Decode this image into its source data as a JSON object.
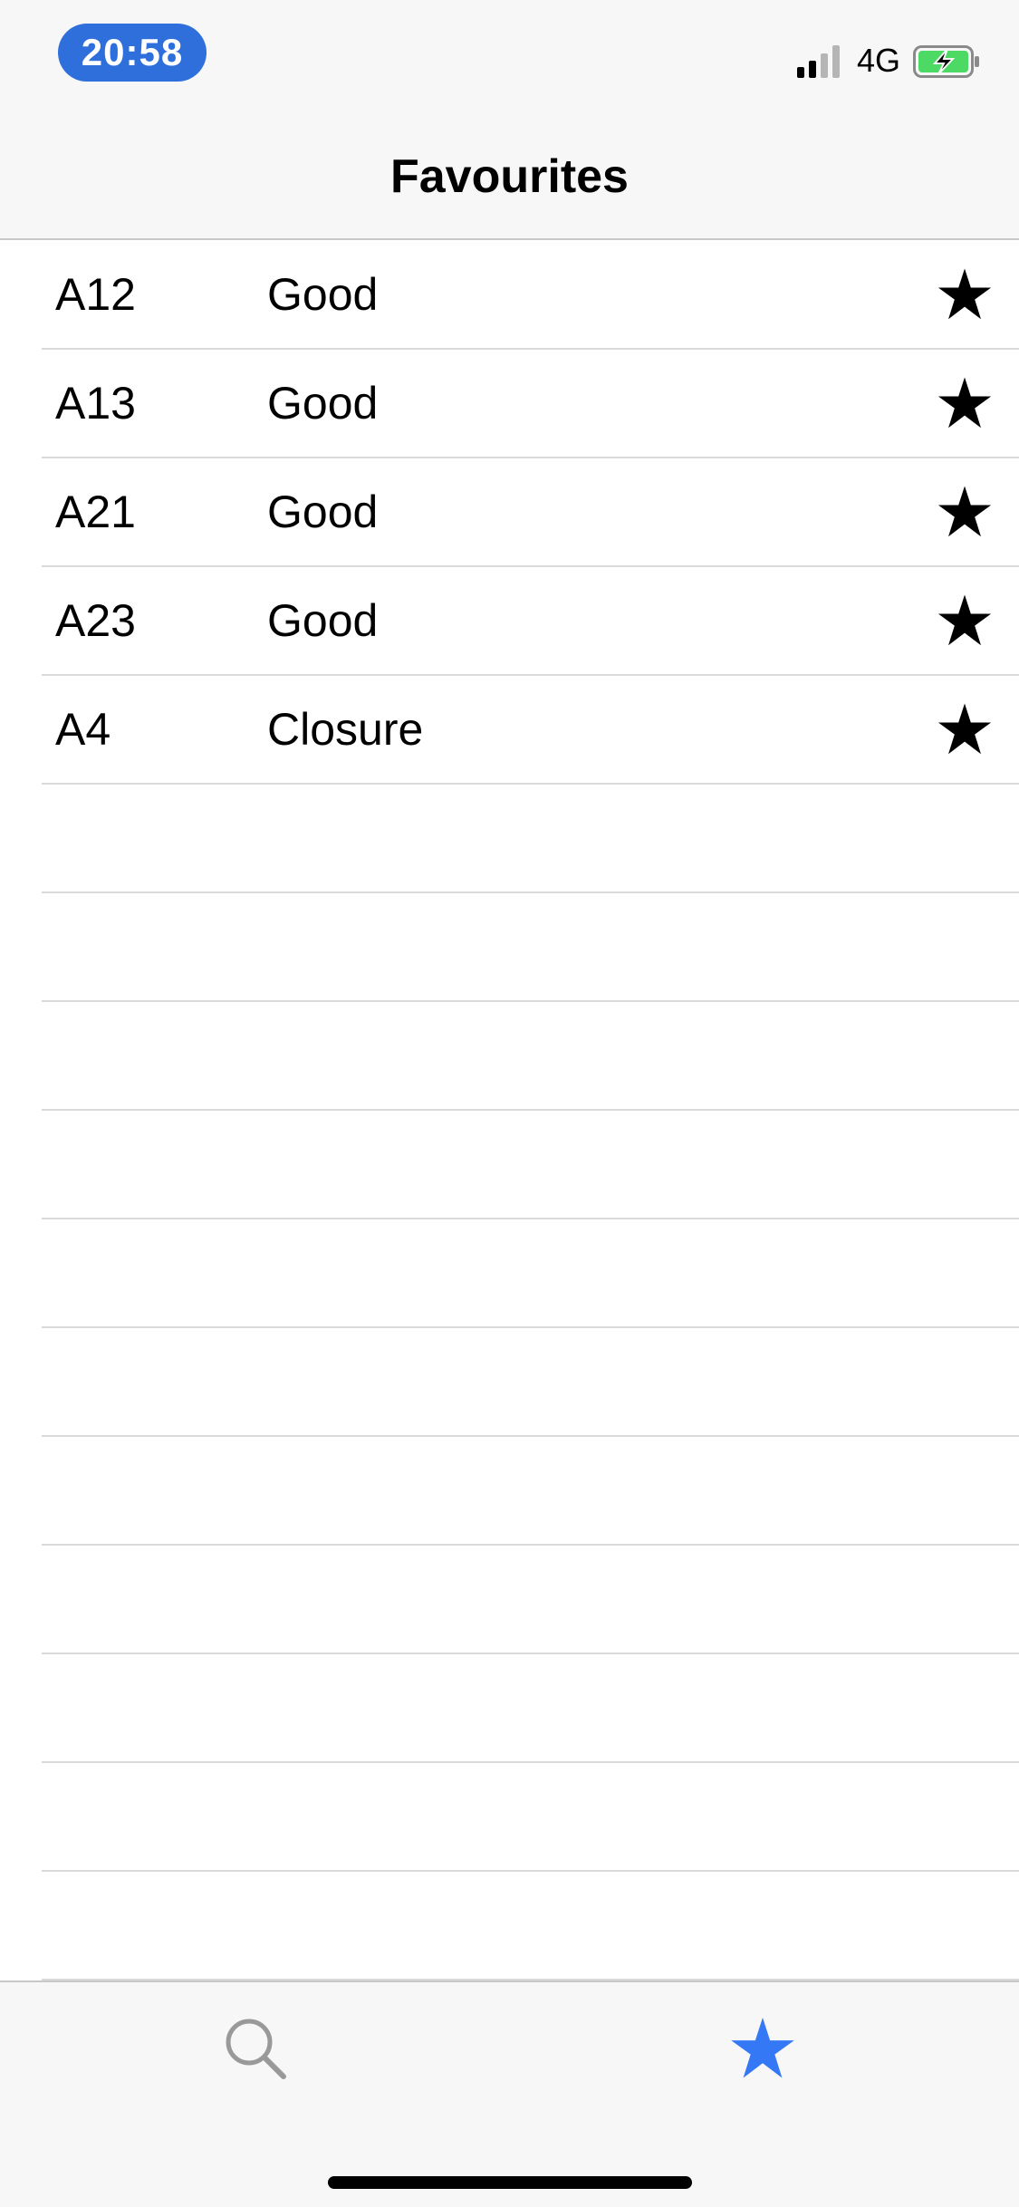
{
  "status_bar": {
    "time": "20:58",
    "network": "4G",
    "time_pill_color": "#2f6fdc",
    "battery_color": "#4cd964",
    "signal_icon": "cellular-signal-icon",
    "battery_icon": "battery-charging-icon"
  },
  "nav": {
    "title": "Favourites"
  },
  "favourites": [
    {
      "road": "A12",
      "status": "Good",
      "icon": "star-filled-icon"
    },
    {
      "road": "A13",
      "status": "Good",
      "icon": "star-filled-icon"
    },
    {
      "road": "A21",
      "status": "Good",
      "icon": "star-filled-icon"
    },
    {
      "road": "A23",
      "status": "Good",
      "icon": "star-filled-icon"
    },
    {
      "road": "A4",
      "status": "Closure",
      "icon": "star-filled-icon"
    }
  ],
  "tab_bar": {
    "tabs": [
      {
        "icon": "magnifying-glass-icon",
        "selected": false,
        "color": "#999999"
      },
      {
        "icon": "star-icon",
        "selected": true,
        "color": "#3478f6"
      }
    ]
  }
}
